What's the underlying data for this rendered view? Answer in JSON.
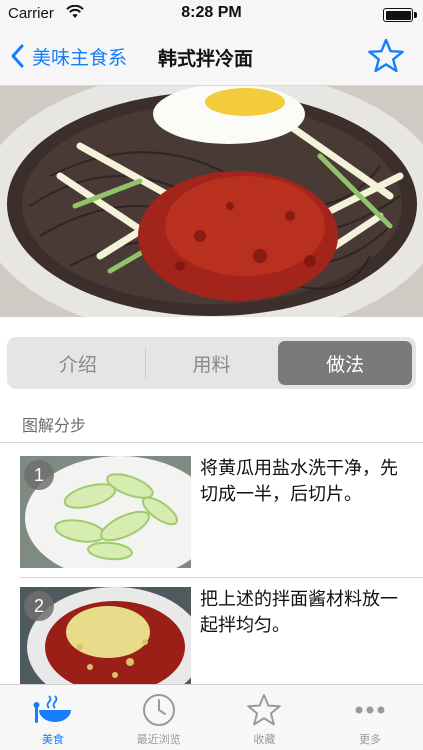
{
  "status_bar": {
    "carrier": "Carrier",
    "time": "8:28 PM"
  },
  "nav": {
    "back_label": "美味主食系",
    "title": "韩式拌冷面"
  },
  "segments": [
    {
      "label": "介绍",
      "active": false
    },
    {
      "label": "用料",
      "active": false
    },
    {
      "label": "做法",
      "active": true
    }
  ],
  "section_label": "图解分步",
  "steps": [
    {
      "number": "1",
      "text": "将黄瓜用盐水洗干净，先切成一半，后切片。"
    },
    {
      "number": "2",
      "text": " 把上述的拌面酱材料放一起拌均匀。"
    }
  ],
  "tabbar": [
    {
      "label": "美食",
      "icon": "food-bowl-icon",
      "active": true
    },
    {
      "label": "最近浏览",
      "icon": "clock-icon",
      "active": false
    },
    {
      "label": "收藏",
      "icon": "star-icon",
      "active": false
    },
    {
      "label": "更多",
      "icon": "more-icon",
      "active": false
    }
  ],
  "colors": {
    "accent": "#157efb",
    "segment_active": "#7a7a7a"
  }
}
